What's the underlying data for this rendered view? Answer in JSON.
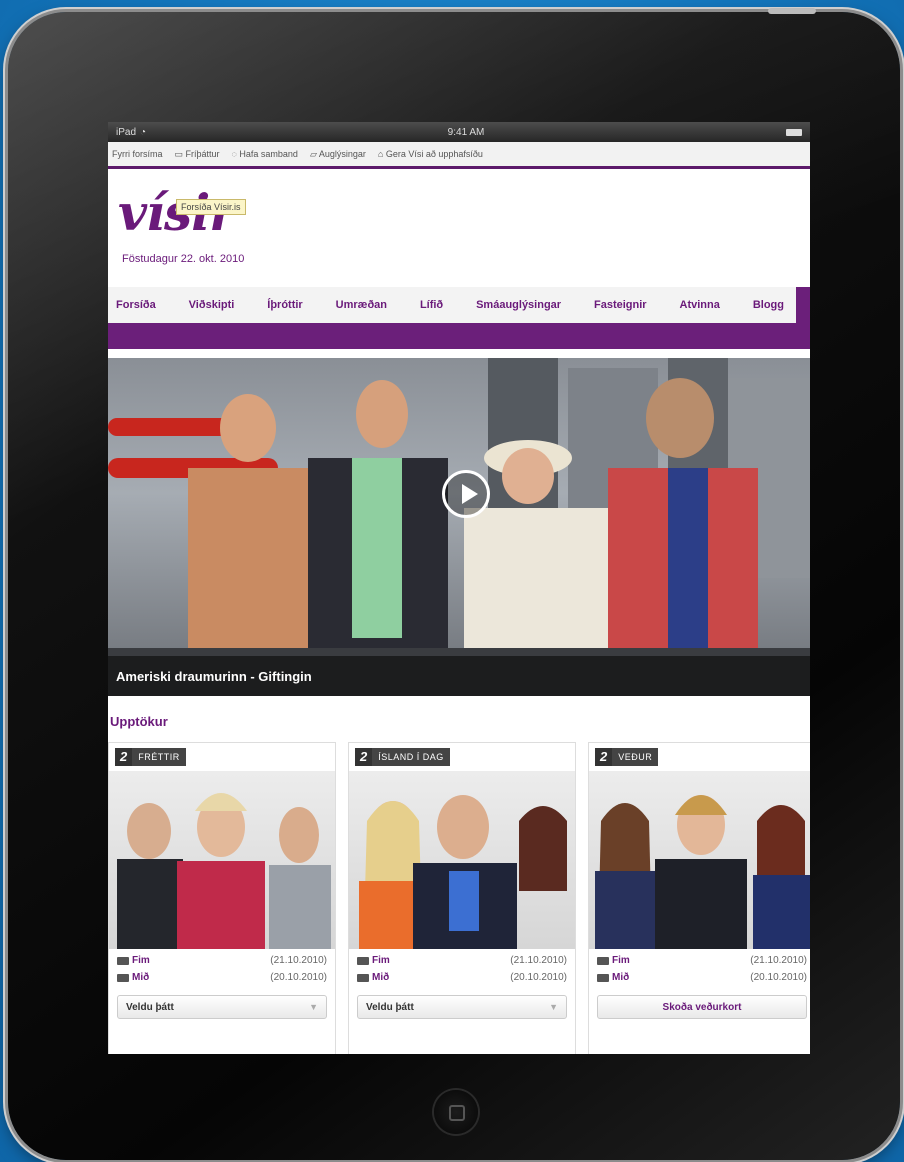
{
  "status_bar": {
    "device": "iPad",
    "time": "9:41 AM"
  },
  "toolbar": {
    "items": [
      "Fyrri forsíma",
      "Fríþáttur",
      "Hafa samband",
      "Auglýsingar",
      "Gera Vísi að upphafsíðu"
    ]
  },
  "masthead": {
    "logo": "vísir",
    "tooltip": "Forsíða Vísir.is",
    "date": "Föstudagur 22. okt. 2010"
  },
  "nav": {
    "items": [
      "Forsíða",
      "Viðskipti",
      "Íþróttir",
      "Umræðan",
      "Lífið",
      "Smáauglýsingar",
      "Fasteignir",
      "Atvinna",
      "Blogg"
    ]
  },
  "hero": {
    "caption": "Ameriski draumurinn - Giftingin"
  },
  "section": {
    "title": "Upptökur"
  },
  "cards": [
    {
      "channel_num": "2",
      "channel_name": "FRÉTTIR",
      "rows": [
        {
          "label": "Fim",
          "date": "(21.10.2010)"
        },
        {
          "label": "Mið",
          "date": "(20.10.2010)"
        }
      ],
      "control": "Veldu þátt"
    },
    {
      "channel_num": "2",
      "channel_name": "ÍSLAND Í DAG",
      "rows": [
        {
          "label": "Fim",
          "date": "(21.10.2010)"
        },
        {
          "label": "Mið",
          "date": "(20.10.2010)"
        }
      ],
      "control": "Veldu þátt"
    },
    {
      "channel_num": "2",
      "channel_name": "VEÐUR",
      "rows": [
        {
          "label": "Fim",
          "date": "(21.10.2010)"
        },
        {
          "label": "Mið",
          "date": "(20.10.2010)"
        }
      ],
      "control": "Skoða veðurkort"
    }
  ],
  "colors": {
    "brand": "#6a1a7a",
    "background": "#1a7fc4"
  }
}
